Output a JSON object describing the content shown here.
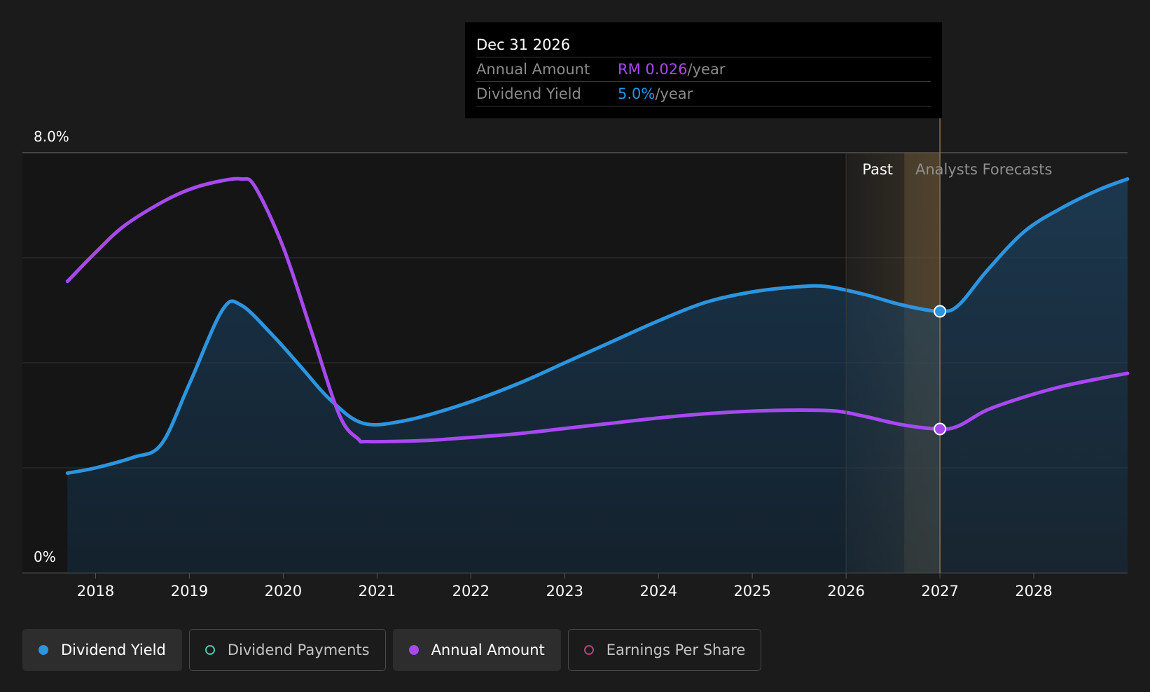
{
  "chart_data": {
    "type": "area",
    "y_axis": {
      "labels": [
        "8.0%",
        "0%"
      ],
      "ylim": [
        0,
        8
      ]
    },
    "x_axis": {
      "ticks": [
        "2018",
        "2019",
        "2020",
        "2021",
        "2022",
        "2023",
        "2024",
        "2025",
        "2026",
        "2027",
        "2028"
      ],
      "xlim": [
        2017.22,
        2029.0
      ]
    },
    "past_label": "Past",
    "forecast_label": "Analysts Forecasts",
    "past_region_start": 2026.0,
    "forecast_start": 2027.0,
    "series": [
      {
        "name": "Dividend Yield",
        "color": "#2b95e0",
        "points": [
          [
            2017.7,
            1.9
          ],
          [
            2018.0,
            2.0
          ],
          [
            2018.4,
            2.2
          ],
          [
            2018.7,
            2.45
          ],
          [
            2019.0,
            3.6
          ],
          [
            2019.35,
            5.0
          ],
          [
            2019.55,
            5.1
          ],
          [
            2019.9,
            4.5
          ],
          [
            2020.2,
            3.9
          ],
          [
            2020.5,
            3.3
          ],
          [
            2020.85,
            2.85
          ],
          [
            2021.3,
            2.9
          ],
          [
            2021.9,
            3.2
          ],
          [
            2022.5,
            3.6
          ],
          [
            2023.0,
            4.0
          ],
          [
            2023.5,
            4.4
          ],
          [
            2024.0,
            4.8
          ],
          [
            2024.5,
            5.15
          ],
          [
            2025.0,
            5.35
          ],
          [
            2025.5,
            5.45
          ],
          [
            2025.8,
            5.45
          ],
          [
            2026.2,
            5.3
          ],
          [
            2026.6,
            5.1
          ],
          [
            2027.0,
            4.98
          ],
          [
            2027.2,
            5.1
          ],
          [
            2027.5,
            5.75
          ],
          [
            2027.9,
            6.5
          ],
          [
            2028.3,
            6.95
          ],
          [
            2028.7,
            7.3
          ],
          [
            2029.0,
            7.5
          ]
        ],
        "highlight": {
          "x": 2027.0,
          "y": 4.98
        }
      },
      {
        "name": "Annual Amount",
        "color": "#a64af0",
        "points": [
          [
            2017.7,
            5.55
          ],
          [
            2018.0,
            6.1
          ],
          [
            2018.3,
            6.6
          ],
          [
            2018.7,
            7.05
          ],
          [
            2019.0,
            7.3
          ],
          [
            2019.3,
            7.45
          ],
          [
            2019.55,
            7.5
          ],
          [
            2019.7,
            7.35
          ],
          [
            2020.0,
            6.2
          ],
          [
            2020.3,
            4.6
          ],
          [
            2020.6,
            3.0
          ],
          [
            2020.8,
            2.55
          ],
          [
            2020.9,
            2.5
          ],
          [
            2021.5,
            2.52
          ],
          [
            2022.0,
            2.58
          ],
          [
            2022.5,
            2.65
          ],
          [
            2023.0,
            2.75
          ],
          [
            2023.5,
            2.85
          ],
          [
            2024.0,
            2.95
          ],
          [
            2024.5,
            3.03
          ],
          [
            2025.0,
            3.08
          ],
          [
            2025.5,
            3.1
          ],
          [
            2025.9,
            3.08
          ],
          [
            2026.2,
            2.98
          ],
          [
            2026.6,
            2.82
          ],
          [
            2027.0,
            2.74
          ],
          [
            2027.2,
            2.8
          ],
          [
            2027.5,
            3.1
          ],
          [
            2027.9,
            3.35
          ],
          [
            2028.3,
            3.55
          ],
          [
            2028.7,
            3.7
          ],
          [
            2029.0,
            3.8
          ]
        ],
        "highlight": {
          "x": 2027.0,
          "y": 2.74
        }
      }
    ],
    "tooltip": {
      "date": "Dec 31 2026",
      "rows": [
        {
          "label": "Annual Amount",
          "value": "RM 0.026",
          "unit": "/year",
          "color": "#a64af0"
        },
        {
          "label": "Dividend Yield",
          "value": "5.0%",
          "unit": "/year",
          "color": "#2b95e0"
        }
      ]
    },
    "legend": [
      {
        "label": "Dividend Yield",
        "active": true,
        "color": "#2b95e0",
        "filled": true
      },
      {
        "label": "Dividend Payments",
        "active": false,
        "color": "#4fc1b0",
        "filled": false
      },
      {
        "label": "Annual Amount",
        "active": true,
        "color": "#a64af0",
        "filled": true
      },
      {
        "label": "Earnings Per Share",
        "active": false,
        "color": "#b0457a",
        "filled": false
      }
    ]
  }
}
